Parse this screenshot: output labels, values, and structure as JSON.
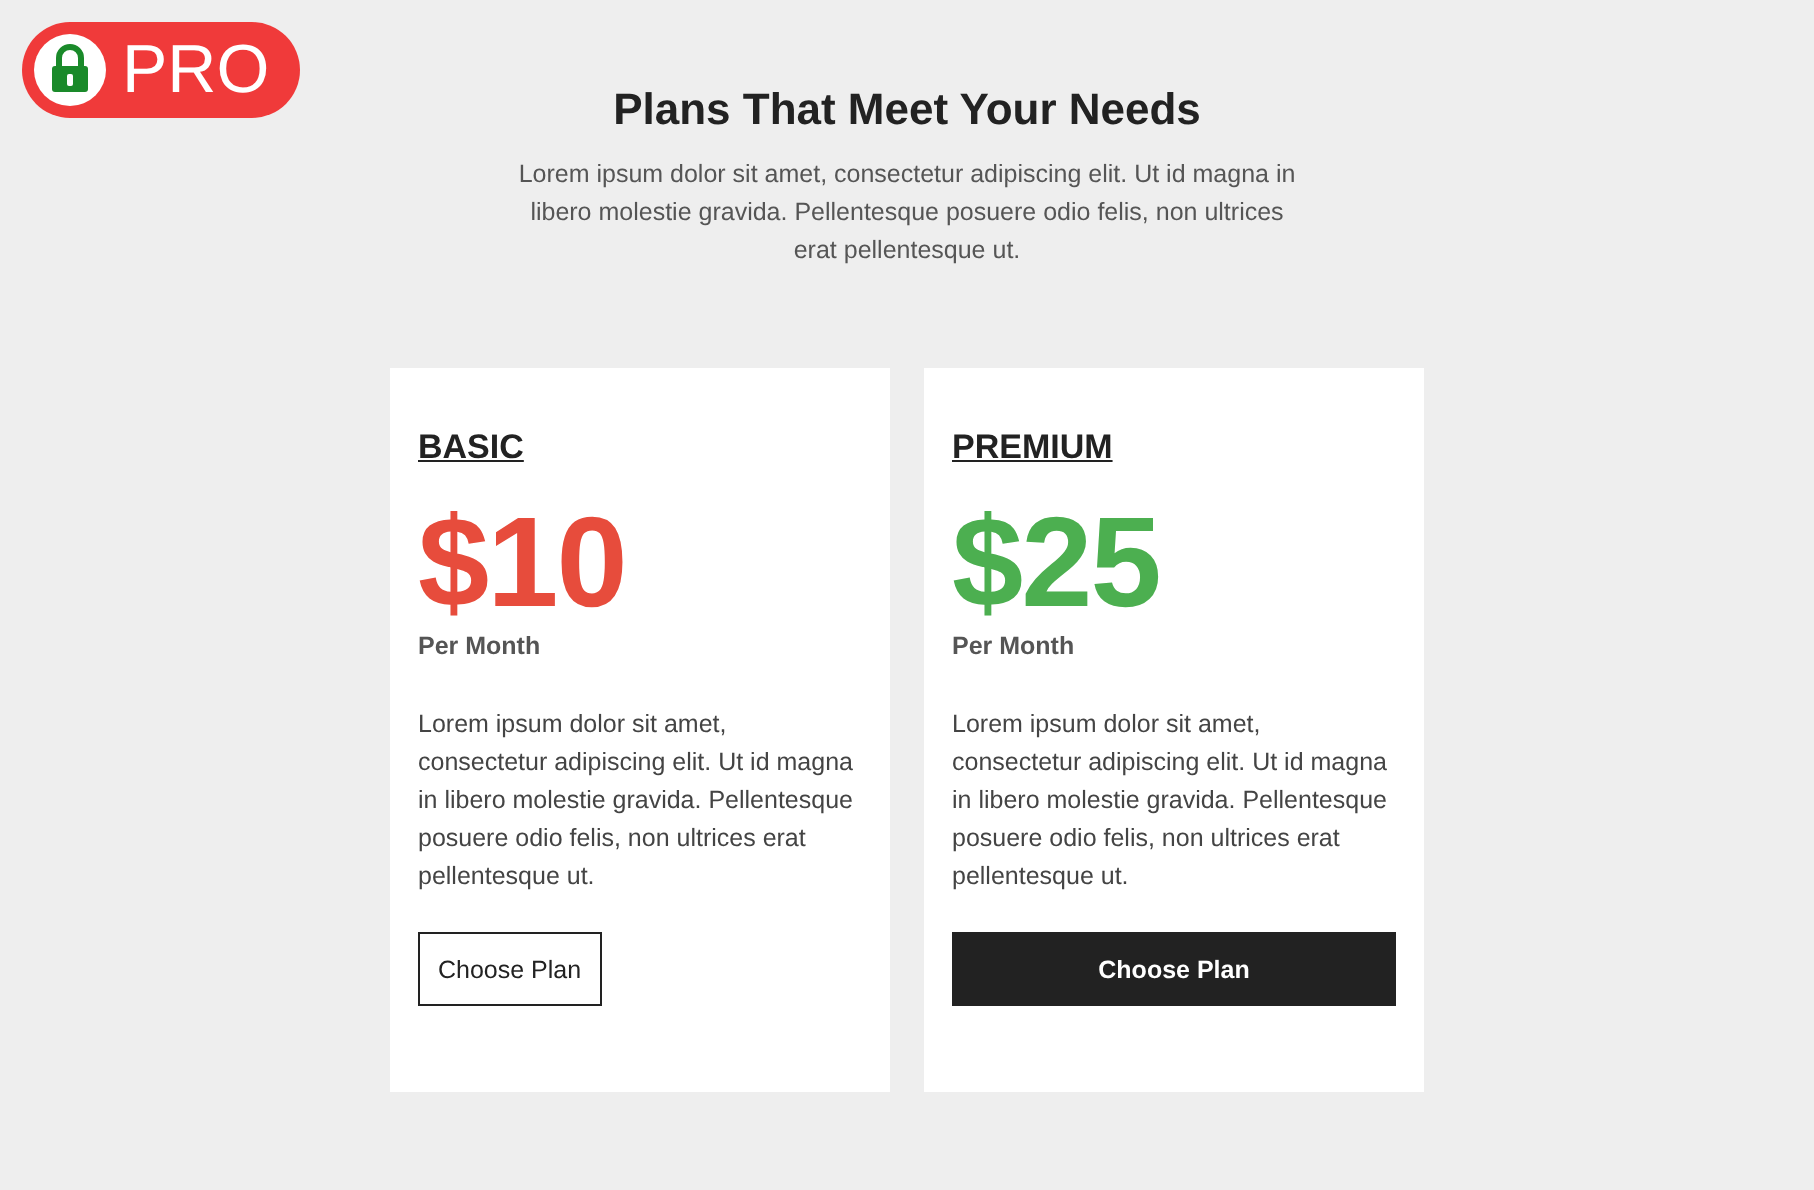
{
  "badge": {
    "label": "PRO"
  },
  "header": {
    "title": "Plans That Meet Your Needs",
    "description": "Lorem ipsum dolor sit amet, consectetur adipiscing elit. Ut id magna in libero molestie gravida. Pellentesque posuere odio felis, non ultrices erat pellentesque ut."
  },
  "plans": [
    {
      "name": "BASIC",
      "price": "$10",
      "period": "Per Month",
      "color": "#e74c3c",
      "description": "Lorem ipsum dolor sit amet, consectetur adipiscing elit. Ut id magna in libero molestie gravida. Pellentesque posuere odio felis, non ultrices erat pellentesque ut.",
      "button": {
        "label": "Choose Plan",
        "kind": "outline"
      }
    },
    {
      "name": "PREMIUM",
      "price": "$25",
      "period": "Per Month",
      "color": "#4caf50",
      "description": "Lorem ipsum dolor sit amet, consectetur adipiscing elit. Ut id magna in libero molestie gravida. Pellentesque posuere odio felis, non ultrices erat pellentesque ut.",
      "button": {
        "label": "Choose Plan",
        "kind": "filled"
      }
    }
  ]
}
